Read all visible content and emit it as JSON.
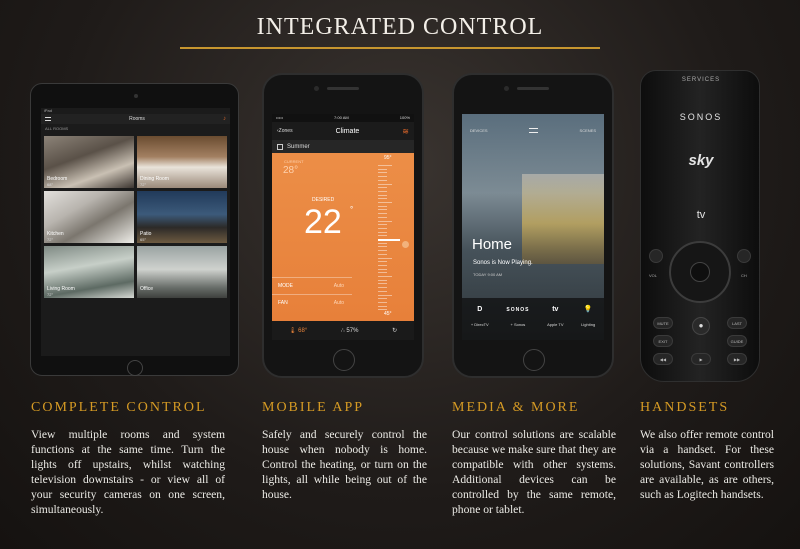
{
  "page": {
    "title": "INTEGRATED CONTROL"
  },
  "tablet": {
    "status_left": "iPad",
    "nav_title": "Rooms",
    "sub": "ALL ROOMS",
    "rooms": [
      {
        "name": "Bedroom",
        "temp": "68°"
      },
      {
        "name": "Dining Room",
        "temp": "72°"
      },
      {
        "name": "Kitchen",
        "temp": "72°"
      },
      {
        "name": "Patio",
        "temp": "65°"
      },
      {
        "name": "Living Room",
        "temp": "72°"
      },
      {
        "name": "Office",
        "temp": ""
      }
    ]
  },
  "climate": {
    "time": "7:00 AM",
    "battery": "100%",
    "back": "Zones",
    "title": "Climate",
    "schedule": "Summer",
    "current_label": "CURRENT",
    "current": "28°",
    "desired_label": "DESIRED",
    "desired": "22",
    "scale_top": "95°",
    "scale_bottom": "45°",
    "mode_label": "MODE",
    "mode_value": "Auto",
    "fan_label": "FAN",
    "fan_value": "Auto",
    "footer_temp": "68°",
    "footer_humidity": "57%"
  },
  "media": {
    "left": "DEVICES",
    "right": "SCENES",
    "home": "Home",
    "now_playing": "Sonos is Now Playing.",
    "time": "TODAY  9:00 AM",
    "sources": [
      {
        "logo": "D",
        "caption": "+ DirecTV"
      },
      {
        "logo": "SONOS",
        "caption": "+ Sonos"
      },
      {
        "logo": "tv",
        "caption": "Apple TV"
      },
      {
        "logo": "",
        "caption": "Lighting"
      }
    ]
  },
  "remote": {
    "services": "SERVICES",
    "sonos": "SONOS",
    "sky": "sky",
    "atv": "tv",
    "vol": "VOL",
    "ch": "CH",
    "mute": "MUTE",
    "last": "LAST",
    "exit": "EXIT",
    "guide": "GUIDE"
  },
  "sections": [
    {
      "heading": "COMPLETE CONTROL",
      "body": "View multiple rooms and system functions at the same time. Turn the lights off upstairs, whilst watching television downstairs - or view all of your security cameras on one screen, simultaneously."
    },
    {
      "heading": "MOBILE APP",
      "body": "Safely and securely control the house when nobody is home. Control the heating, or turn on the lights, all while being out of the house."
    },
    {
      "heading": "MEDIA & MORE",
      "body": "Our control solutions are scalable because we make sure that they are compatible with other systems. Additional devices can be controlled by the same remote, phone or tablet."
    },
    {
      "heading": "HANDSETS",
      "body": "We also offer remote control via a handset. For these solutions, Savant controllers are available, as are others, such as Logitech handsets."
    }
  ]
}
